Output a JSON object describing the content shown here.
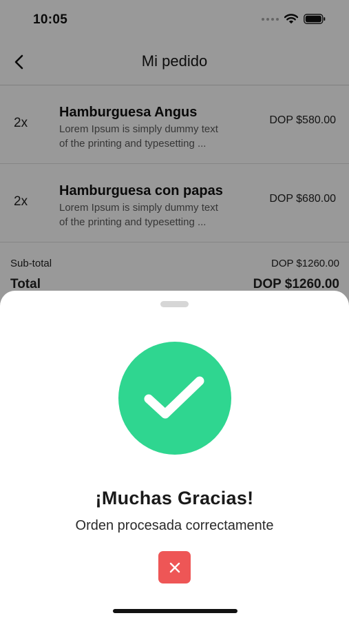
{
  "status_bar": {
    "time": "10:05"
  },
  "header": {
    "title": "Mi pedido",
    "back_icon": "chevron-left-icon"
  },
  "order": {
    "items": [
      {
        "qty": "2x",
        "name": "Hamburguesa Angus",
        "desc_line1": "Lorem Ipsum is simply dummy text",
        "desc_line2": "of the printing and typesetting ...",
        "price": "DOP $580.00"
      },
      {
        "qty": "2x",
        "name": "Hamburguesa con papas",
        "desc_line1": "Lorem Ipsum is simply dummy text",
        "desc_line2": "of the printing and typesetting ...",
        "price": "DOP $680.00"
      }
    ],
    "subtotal_label": "Sub-total",
    "subtotal_value": "DOP $1260.00",
    "total_label": "Total",
    "total_value": "DOP $1260.00"
  },
  "modal": {
    "icon": "check-icon",
    "title": "¡Muchas Gracias!",
    "subtitle": "Orden procesada correctamente",
    "close_icon": "close-icon"
  },
  "colors": {
    "success": "#2fd690",
    "danger": "#ee5656",
    "overlay": "rgba(0,0,0,0.4)"
  }
}
